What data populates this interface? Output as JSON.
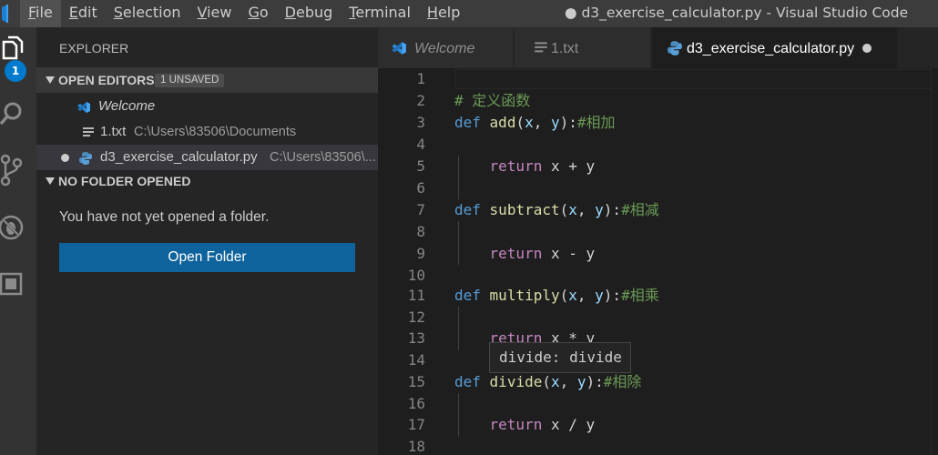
{
  "window": {
    "title": "● d3_exercise_calculator.py - Visual Studio Code"
  },
  "menu": [
    {
      "mnemonic": "F",
      "rest": "ile"
    },
    {
      "mnemonic": "E",
      "rest": "dit"
    },
    {
      "mnemonic": "S",
      "rest": "election"
    },
    {
      "mnemonic": "V",
      "rest": "iew"
    },
    {
      "mnemonic": "G",
      "rest": "o"
    },
    {
      "mnemonic": "D",
      "rest": "ebug"
    },
    {
      "mnemonic": "T",
      "rest": "erminal"
    },
    {
      "mnemonic": "H",
      "rest": "elp"
    }
  ],
  "activity": {
    "badge": "1"
  },
  "sidebar": {
    "title": "EXPLORER",
    "open_editors": {
      "label": "OPEN EDITORS",
      "badge": "1 UNSAVED",
      "items": [
        {
          "name": "Welcome",
          "path": ""
        },
        {
          "name": "1.txt",
          "path": "C:\\Users\\83506\\Documents"
        },
        {
          "name": "d3_exercise_calculator.py",
          "path": "C:\\Users\\83506\\..."
        }
      ]
    },
    "no_folder": {
      "label": "NO FOLDER OPENED",
      "message": "You have not yet opened a folder.",
      "button": "Open Folder"
    }
  },
  "tabs": [
    {
      "label": "Welcome"
    },
    {
      "label": "1.txt"
    },
    {
      "label": "d3_exercise_calculator.py"
    }
  ],
  "editor": {
    "line_numbers": [
      "1",
      "2",
      "3",
      "4",
      "5",
      "6",
      "7",
      "8",
      "9",
      "10",
      "11",
      "12",
      "13",
      "14",
      "15",
      "16",
      "17",
      "18"
    ],
    "comment_heading": "# 定义函数",
    "def_kw": "def",
    "return_kw": "return",
    "functions": [
      {
        "name": "add",
        "params": [
          "x",
          "y"
        ],
        "comment": "#相加",
        "op": "+"
      },
      {
        "name": "subtract",
        "params": [
          "x",
          "y"
        ],
        "comment": "#相减",
        "op": "-"
      },
      {
        "name": "multiply",
        "params": [
          "x",
          "y"
        ],
        "comment": "#相乘",
        "op": "*"
      },
      {
        "name": "divide",
        "params": [
          "x",
          "y"
        ],
        "comment": "#相除",
        "op": "/"
      }
    ],
    "tooltip": "divide: divide"
  },
  "colors": {
    "accent": "#007acc",
    "button": "#0e639c",
    "keyword": "#569cd6",
    "function": "#dcdcaa",
    "parameter": "#9cdcfe",
    "comment": "#6a9955",
    "control": "#c586c0"
  },
  "icons": {
    "app": "vscode-logo-icon",
    "explorer": "files-icon",
    "search": "search-icon",
    "scm": "source-control-icon",
    "debug": "debug-icon",
    "extensions": "extensions-icon",
    "python": "python-file-icon",
    "text": "text-file-icon"
  }
}
